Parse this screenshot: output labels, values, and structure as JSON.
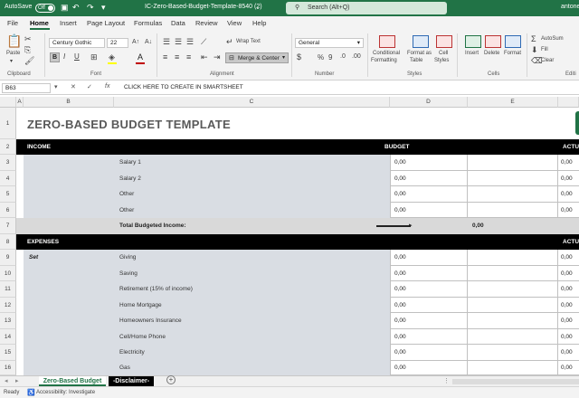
{
  "titlebar": {
    "autosave_label": "AutoSave",
    "autosave_state": "Off",
    "filename": "IC-Zero-Based-Budget-Template-8540 (2)",
    "search_placeholder": "Search (Alt+Q)",
    "user": "antone"
  },
  "menu": {
    "tabs": [
      "File",
      "Home",
      "Insert",
      "Page Layout",
      "Formulas",
      "Data",
      "Review",
      "View",
      "Help"
    ],
    "active": "Home"
  },
  "ribbon": {
    "paste_label": "Paste",
    "font_name": "Century Gothic",
    "font_size": "22",
    "wrap_text": "Wrap Text",
    "merge_center": "Merge & Center",
    "number_format": "General",
    "percent": "%",
    "comma": "9",
    "conditional": [
      "Conditional",
      "Formatting"
    ],
    "format_as_table": [
      "Format as",
      "Table"
    ],
    "cell_styles": [
      "Cell",
      "Styles"
    ],
    "insert": "Insert",
    "delete": "Delete",
    "format": "Format",
    "autosum": "AutoSum",
    "fill": "Fill",
    "clear": "Clear",
    "groups": {
      "clipboard": "Clipboard",
      "font": "Font",
      "alignment": "Alignment",
      "number": "Number",
      "styles": "Styles",
      "cells": "Cells",
      "editing": "Editi"
    },
    "colors": {
      "accent": "#217346",
      "font_color": "#c00000",
      "highlight": "#ffff00"
    }
  },
  "formula_bar": {
    "name_box": "B63",
    "content": "CLICK HERE TO CREATE IN SMARTSHEET"
  },
  "columns": [
    "A",
    "B",
    "C",
    "D",
    "E"
  ],
  "rows": [
    {
      "num": "1"
    },
    {
      "num": "2"
    },
    {
      "num": "3"
    },
    {
      "num": "4"
    },
    {
      "num": "5"
    },
    {
      "num": "6"
    },
    {
      "num": "7"
    },
    {
      "num": "8"
    },
    {
      "num": "9"
    },
    {
      "num": "10"
    },
    {
      "num": "11"
    },
    {
      "num": "12"
    },
    {
      "num": "13"
    },
    {
      "num": "14"
    },
    {
      "num": "15"
    },
    {
      "num": "16"
    }
  ],
  "sheet": {
    "title": "ZERO-BASED BUDGET TEMPLATE",
    "income_header": "INCOME",
    "budget_header": "BUDGET",
    "actual_header": "ACTU",
    "income_items": [
      {
        "label": "Salary 1",
        "budget": "0,00"
      },
      {
        "label": "Salary 2",
        "budget": "0,00"
      },
      {
        "label": "Other",
        "budget": "0,00"
      },
      {
        "label": "Other",
        "budget": "0,00"
      }
    ],
    "total_label": "Total Budgeted Income:",
    "total_value": "0,00",
    "expenses_header": "EXPENSES",
    "expenses_actual_header": "ACTU",
    "set_label": "Set",
    "expense_items": [
      {
        "label": "Giving",
        "budget": "0,00",
        "actual": "0,00"
      },
      {
        "label": "Saving",
        "budget": "0,00",
        "actual": "0,00"
      },
      {
        "label": "Retirement (15% of income)",
        "budget": "0,00",
        "actual": "0,00"
      },
      {
        "label": "Home Mortgage",
        "budget": "0,00",
        "actual": "0,00"
      },
      {
        "label": "Homeowners Insurance",
        "budget": "0,00",
        "actual": "0,00"
      },
      {
        "label": "Cell/Home Phone",
        "budget": "0,00",
        "actual": "0,00"
      },
      {
        "label": "Electricity",
        "budget": "0,00",
        "actual": "0,00"
      },
      {
        "label": "Gas",
        "budget": "0,00",
        "actual": "0,00"
      }
    ],
    "income_actual": [
      "0,00",
      "0,00",
      "0,00",
      "0,00"
    ]
  },
  "sheet_tabs": [
    "Zero-Based Budget",
    "-Disclaimer-"
  ],
  "status": {
    "ready": "Ready",
    "accessibility": "Accessibility: Investigate"
  }
}
